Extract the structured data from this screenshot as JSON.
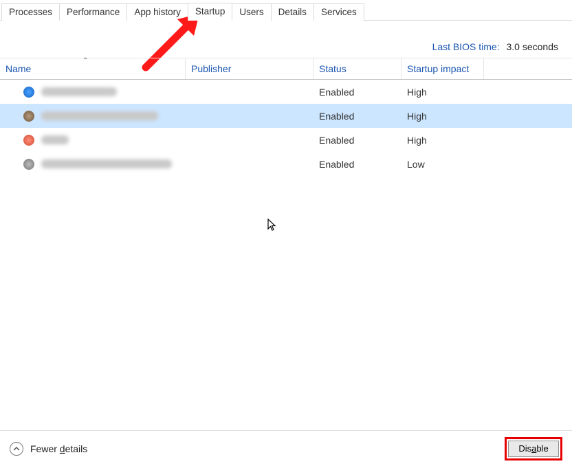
{
  "tabs": {
    "items": [
      {
        "label": "Processes",
        "active": false
      },
      {
        "label": "Performance",
        "active": false
      },
      {
        "label": "App history",
        "active": false
      },
      {
        "label": "Startup",
        "active": true
      },
      {
        "label": "Users",
        "active": false
      },
      {
        "label": "Details",
        "active": false
      },
      {
        "label": "Services",
        "active": false
      }
    ]
  },
  "bios": {
    "label": "Last BIOS time:",
    "value": "3.0 seconds"
  },
  "columns": {
    "name": "Name",
    "publisher": "Publisher",
    "status": "Status",
    "impact": "Startup impact",
    "sort_indicator": "⌃"
  },
  "rows": [
    {
      "icon": "ic-blue",
      "name_w": 110,
      "pub_w": 140,
      "status": "Enabled",
      "impact": "High",
      "selected": false
    },
    {
      "icon": "ic-brown",
      "name_w": 170,
      "pub_w": 150,
      "status": "Enabled",
      "impact": "High",
      "selected": true
    },
    {
      "icon": "ic-red",
      "name_w": 40,
      "pub_w": 140,
      "status": "Enabled",
      "impact": "High",
      "selected": false
    },
    {
      "icon": "ic-grey",
      "name_w": 190,
      "pub_w": 140,
      "status": "Enabled",
      "impact": "Low",
      "selected": false
    }
  ],
  "footer": {
    "fewer_prefix": "Fewer ",
    "fewer_u": "d",
    "fewer_suffix": "etails",
    "disable_prefix": "Dis",
    "disable_u": "a",
    "disable_suffix": "ble"
  },
  "annotations": {
    "arrow_color": "#ff1a1a",
    "highlight_color": "#e60000"
  }
}
